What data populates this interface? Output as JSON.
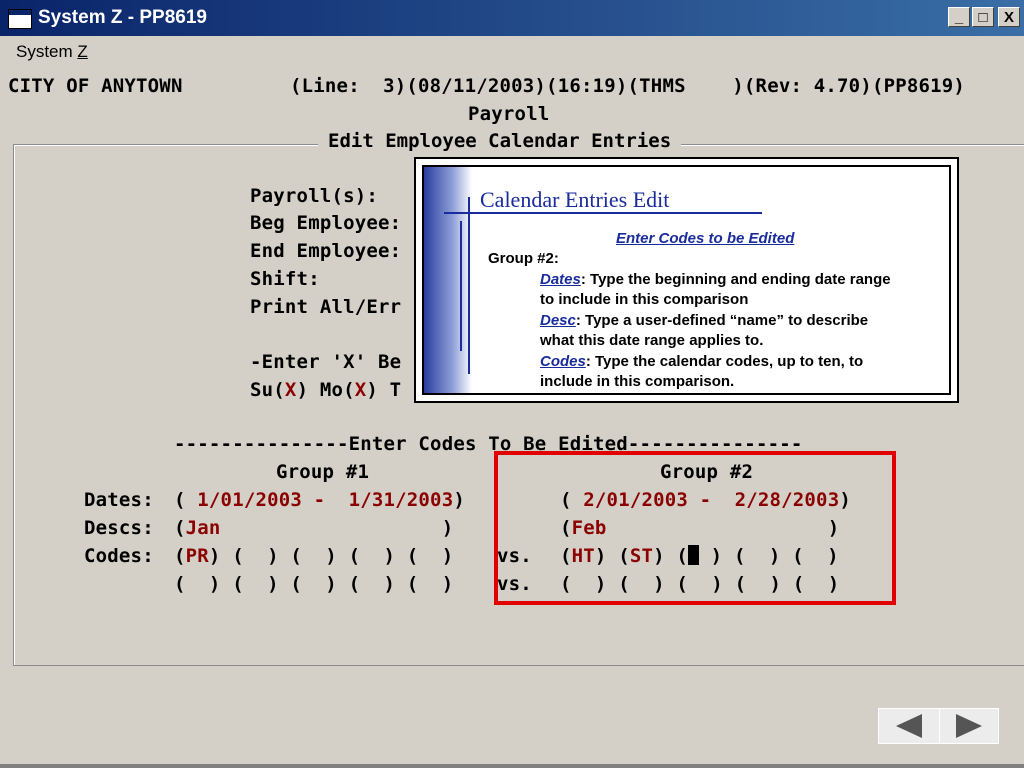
{
  "window": {
    "title": "System Z - PP8619",
    "buttons": {
      "minimize": "_",
      "maximize": "□",
      "close": "X"
    }
  },
  "menu": {
    "system_pre": "System ",
    "system_key": "Z"
  },
  "header": {
    "org": "CITY OF ANYTOWN",
    "status": "(Line:  3)(08/11/2003)(16:19)(THMS    )(Rev: 4.70)(PP8619)",
    "module": "Payroll",
    "screen_title": "Edit Employee Calendar Entries"
  },
  "fields": {
    "payrolls": "Payroll(s):",
    "beg_employee": "Beg Employee:",
    "end_employee": "End Employee:",
    "shift": "Shift:",
    "print": "Print All/Err",
    "enter_x": "-Enter 'X' Be",
    "days_su": "Su(",
    "days_x1": "X",
    "days_mo": ") Mo(",
    "days_x2": "X",
    "days_t": ") T"
  },
  "codes_section": {
    "divider": "---------------Enter Codes To Be Edited---------------",
    "group1_label": "Group #1",
    "group2_label": "Group #2",
    "dates_label": "Dates:",
    "descs_label": "Descs:",
    "codes_label": "Codes:",
    "g1_dates_open": "( ",
    "g1_dates_value": "1/01/2003 -  1/31/2003",
    "g1_dates_close": ")",
    "g1_desc_open": "(",
    "g1_desc_value": "Jan",
    "g1_desc_close": "                   )",
    "g1_code1": "PR",
    "g1_codes_rest1": ") (  ) (  ) (  ) (  )",
    "g1_codes_row2": "(  ) (  ) (  ) (  ) (  )",
    "vs": "vs.",
    "g2_dates_open": "( ",
    "g2_dates_value": "2/01/2003 -  2/28/2003",
    "g2_dates_close": ")",
    "g2_desc_open": "(",
    "g2_desc_value": "Feb",
    "g2_desc_close": "                   )",
    "g2_code1": "HT",
    "g2_code2": "ST",
    "g2_codes_rest1": " ) (  ) (  )",
    "g2_codes_row2": "(  ) (  ) (  ) (  ) (  )"
  },
  "callout": {
    "title": "Calendar Entries Edit",
    "subtitle": "Enter Codes to be Edited",
    "group": "Group #2:",
    "dates_kw": "Dates",
    "dates_text1": ":  Type the beginning and ending date range",
    "dates_text2": "to include in this comparison",
    "desc_kw": "Desc",
    "desc_text1": ":  Type a user-defined “name” to describe",
    "desc_text2": "what this date range applies to.",
    "codes_kw": "Codes",
    "codes_text1": ":  Type the calendar codes, up to ten, to",
    "codes_text2": "include in this comparison."
  },
  "colors": {
    "highlight": "#e00000",
    "callout_accent": "#1a2c9c",
    "value_red": "#8b0000"
  }
}
